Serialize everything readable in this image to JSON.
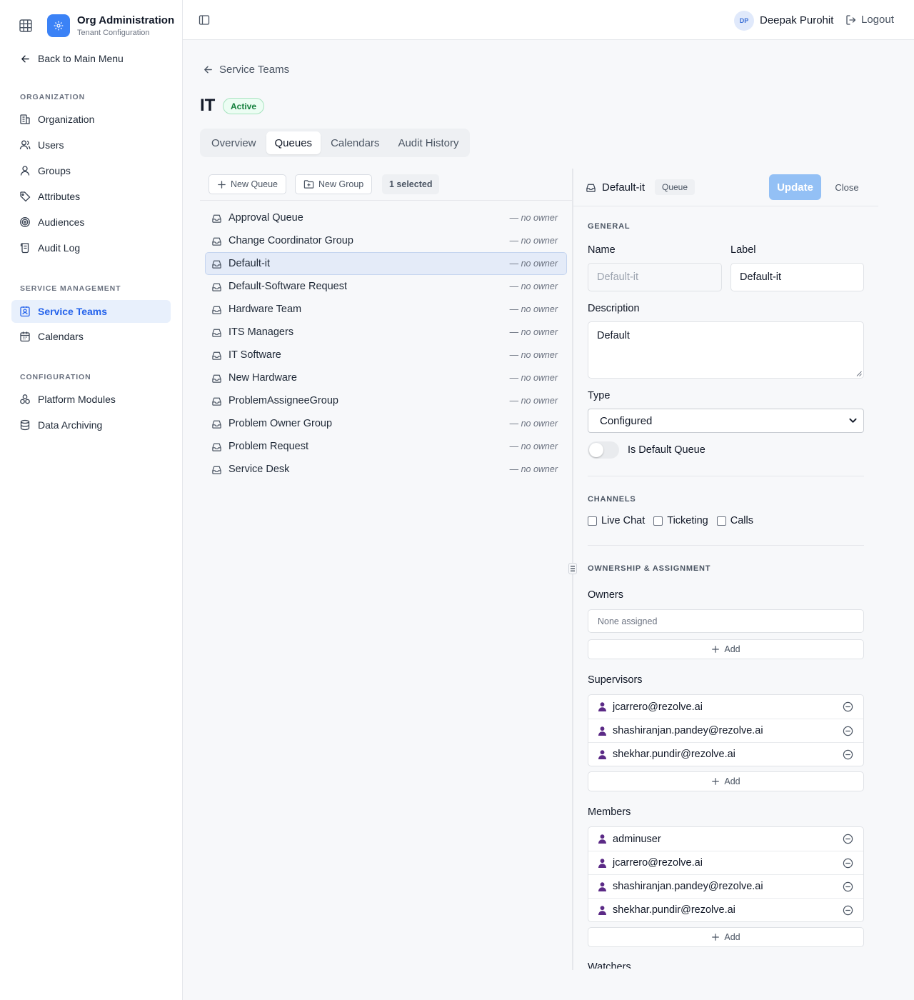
{
  "app": {
    "title": "Org Administration",
    "subtitle": "Tenant Configuration",
    "back_label": "Back to Main Menu"
  },
  "sidebar": {
    "sections": [
      {
        "label": "ORGANIZATION",
        "items": [
          {
            "label": "Organization",
            "icon": "building-icon"
          },
          {
            "label": "Users",
            "icon": "user-icon"
          },
          {
            "label": "Groups",
            "icon": "users-icon"
          },
          {
            "label": "Attributes",
            "icon": "tag-icon"
          },
          {
            "label": "Audiences",
            "icon": "target-icon"
          },
          {
            "label": "Audit Log",
            "icon": "scroll-icon"
          }
        ]
      },
      {
        "label": "SERVICE MANAGEMENT",
        "items": [
          {
            "label": "Service Teams",
            "icon": "contact-icon",
            "active": true
          },
          {
            "label": "Calendars",
            "icon": "calendar-icon"
          }
        ]
      },
      {
        "label": "CONFIGURATION",
        "items": [
          {
            "label": "Platform Modules",
            "icon": "modules-icon"
          },
          {
            "label": "Data Archiving",
            "icon": "database-icon"
          }
        ]
      }
    ]
  },
  "header": {
    "user_initials": "DP",
    "user_name": "Deepak Purohit",
    "logout_label": "Logout"
  },
  "page": {
    "breadcrumb": "Service Teams",
    "title": "IT",
    "status": "Active",
    "tabs": [
      "Overview",
      "Queues",
      "Calendars",
      "Audit History"
    ],
    "active_tab": "Queues"
  },
  "toolbar": {
    "new_queue": "New Queue",
    "new_group": "New Group",
    "selected_count": "1 selected"
  },
  "queues": [
    {
      "name": "Approval Queue",
      "owner": "— no owner"
    },
    {
      "name": "Change Coordinator Group",
      "owner": "— no owner"
    },
    {
      "name": "Default-it",
      "owner": "— no owner",
      "selected": true
    },
    {
      "name": "Default-Software Request",
      "owner": "— no owner"
    },
    {
      "name": "Hardware Team",
      "owner": "— no owner"
    },
    {
      "name": "ITS Managers",
      "owner": "— no owner"
    },
    {
      "name": "IT Software",
      "owner": "— no owner"
    },
    {
      "name": "New Hardware",
      "owner": "— no owner"
    },
    {
      "name": "ProblemAssigneeGroup",
      "owner": "— no owner"
    },
    {
      "name": "Problem Owner Group",
      "owner": "— no owner"
    },
    {
      "name": "Problem Request",
      "owner": "— no owner"
    },
    {
      "name": "Service Desk",
      "owner": "— no owner"
    }
  ],
  "detail": {
    "title": "Default-it",
    "type_badge": "Queue",
    "update_label": "Update",
    "close_label": "Close",
    "general_label": "GENERAL",
    "name_label": "Name",
    "name_value": "Default-it",
    "label_label": "Label",
    "label_value": "Default-it",
    "description_label": "Description",
    "description_value": "Default",
    "type_label": "Type",
    "type_value": "Configured",
    "is_default_label": "Is Default Queue",
    "is_default": false,
    "channels_label": "CHANNELS",
    "channels": [
      {
        "label": "Live Chat",
        "checked": false
      },
      {
        "label": "Ticketing",
        "checked": false
      },
      {
        "label": "Calls",
        "checked": false
      }
    ],
    "ownership_label": "OWNERSHIP & ASSIGNMENT",
    "owners_label": "Owners",
    "owners_empty": "None assigned",
    "add_label": "Add",
    "supervisors_label": "Supervisors",
    "supervisors": [
      "jcarrero@rezolve.ai",
      "shashiranjan.pandey@rezolve.ai",
      "shekhar.pundir@rezolve.ai"
    ],
    "members_label": "Members",
    "members": [
      "adminuser",
      "jcarrero@rezolve.ai",
      "shashiranjan.pandey@rezolve.ai",
      "shekhar.pundir@rezolve.ai"
    ],
    "watchers_label": "Watchers"
  },
  "colors": {
    "accent": "#3b82f6",
    "active_nav_bg": "#e8f0fc",
    "active_nav_text": "#2563eb",
    "status_green": "#15803d",
    "person_icon": "#5b2a86"
  }
}
